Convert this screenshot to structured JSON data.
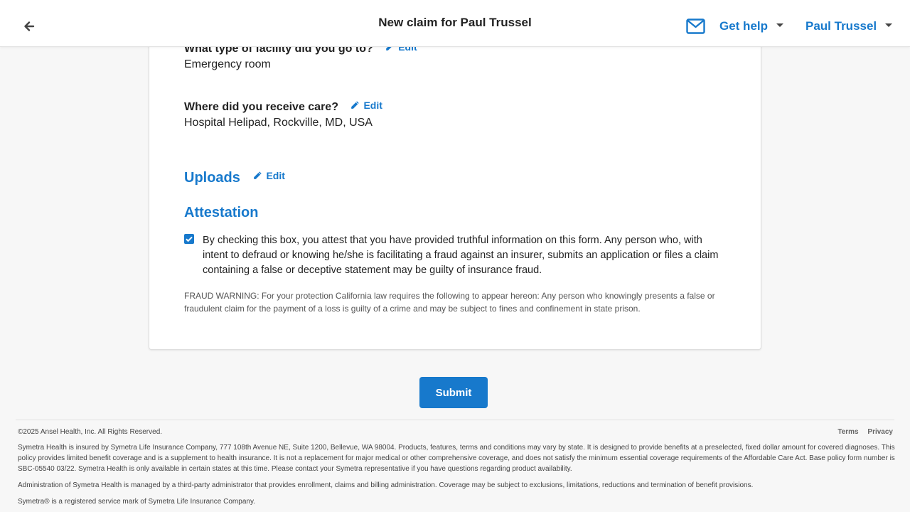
{
  "header": {
    "title": "New claim for Paul Trussel",
    "help_label": "Get help",
    "user_label": "Paul Trussel",
    "icons": {
      "back": "arrow-left-icon",
      "mail": "envelope-icon"
    }
  },
  "questions": [
    {
      "label": "What type of facility did you go to?",
      "answer": "Emergency room",
      "edit_label": "Edit"
    },
    {
      "label": "Where did you receive care?",
      "answer": "Hospital Helipad, Rockville, MD, USA",
      "edit_label": "Edit"
    }
  ],
  "uploads": {
    "title": "Uploads",
    "edit_label": "Edit"
  },
  "attestation": {
    "title": "Attestation",
    "checked": true,
    "text": "By checking this box, you attest that you have provided truthful information on this form. Any person who, with intent to defraud or knowing he/she is facilitating a fraud against an insurer, submits an application or files a claim containing a false or deceptive statement may be guilty of insurance fraud.",
    "fraud_warning": "FRAUD WARNING: For your protection California law requires the following to appear hereon: Any person who knowingly presents a false or fraudulent claim for the payment of a loss is guilty of a crime and may be subject to fines and confinement in state prison."
  },
  "submit_label": "Submit",
  "footer": {
    "copyright": "©2025 Ansel Health, Inc. All Rights Reserved.",
    "links": [
      "Terms",
      "Privacy"
    ],
    "legal_1": "Symetra Health is insured by Symetra Life Insurance Company, 777 108th Avenue NE, Suite 1200, Bellevue, WA 98004. Products, features, terms and conditions may vary by state. It is designed to provide benefits at a preselected, fixed dollar amount for covered diagnoses. This policy provides limited benefit coverage and is a supplement to health insurance. It is not a replacement for major medical or other comprehensive coverage, and does not satisfy the minimum essential coverage requirements of the Affordable Care Act. Base policy form number is SBC-05540 03/22. Symetra Health is only available in certain states at this time. Please contact your Symetra representative if you have questions regarding product availability.",
    "legal_2": "Administration of Symetra Health is managed by a third-party administrator that provides enrollment, claims and billing administration. Coverage may be subject to exclusions, limitations, reductions and termination of benefit provisions.",
    "legal_3": "Symetra® is a registered service mark of Symetra Life Insurance Company."
  },
  "colors": {
    "accent": "#1779cc",
    "text": "#222222",
    "background": "#f7f7f7"
  }
}
